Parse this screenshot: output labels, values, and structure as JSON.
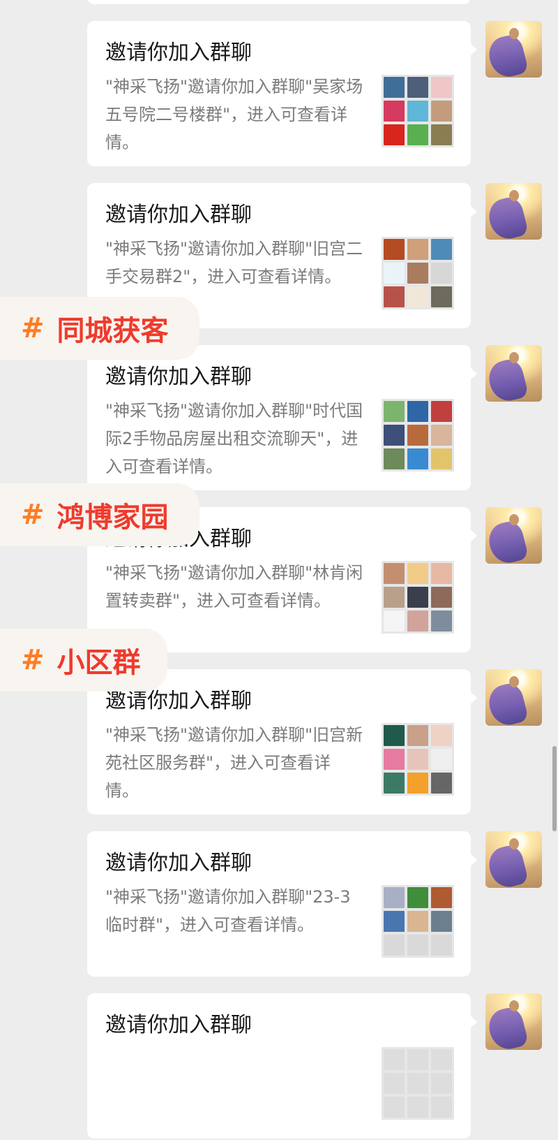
{
  "messages": [
    {
      "title": "邀请你加入群聊",
      "desc": "\"神采飞扬\"邀请你加入群聊\"吴家场五号院二号楼群\"，进入可查看详情。",
      "members": [
        "#3f6f98",
        "#4e5f79",
        "#f0c6c6",
        "#d53a5f",
        "#5fb7d8",
        "#c39c7d",
        "#d8261d",
        "#59b051",
        "#8a7d52"
      ]
    },
    {
      "title": "邀请你加入群聊",
      "desc": "\"神采飞扬\"邀请你加入群聊\"旧宫二手交易群2\"，进入可查看详情。",
      "members": [
        "#b54b22",
        "#cfa07a",
        "#4e8bb8",
        "#eaf3f8",
        "#a97b5f",
        "#d7d7d7",
        "#b7524a",
        "#f1e7d9",
        "#6d6b5b"
      ]
    },
    {
      "title": "邀请你加入群聊",
      "desc": "\"神采飞扬\"邀请你加入群聊\"时代国际2手物品房屋出租交流聊天\"，进入可查看详情。",
      "members": [
        "#7cb46e",
        "#2f66a7",
        "#c23f3f",
        "#3e4f7a",
        "#b96a3d",
        "#d8b59d",
        "#6d8a5b",
        "#3a8ad1",
        "#e2c46b"
      ]
    },
    {
      "title": "邀请你加入群聊",
      "desc": "\"神采飞扬\"邀请你加入群聊\"林肯闲置转卖群\"，进入可查看详情。",
      "members": [
        "#c38f70",
        "#f2cb89",
        "#e7b9a5",
        "#b8a08a",
        "#3b3f4d",
        "#8e6a5b",
        "#f5f5f5",
        "#d2a39b",
        "#7d8d9e"
      ]
    },
    {
      "title": "邀请你加入群聊",
      "desc": "\"神采飞扬\"邀请你加入群聊\"旧宫新苑社区服务群\"，进入可查看详情。",
      "members": [
        "#1f5a4b",
        "#c9a089",
        "#f0d1c5",
        "#e77aa0",
        "#e6c4b9",
        "#efefef",
        "#3d7a65",
        "#f4a12b",
        "#666666"
      ]
    },
    {
      "title": "邀请你加入群聊",
      "desc": "\"神采飞扬\"邀请你加入群聊\"23-3临时群\"，进入可查看详情。",
      "members": [
        "#a8b0c5",
        "#3f8e3a",
        "#b05a32",
        "#4a76b0",
        "#d9b592",
        "#6b7f8f",
        "#d9d9d9",
        "#d9d9d9",
        "#d9d9d9"
      ]
    },
    {
      "title": "邀请你加入群聊",
      "desc": "",
      "members": [
        "#dddddd",
        "#dddddd",
        "#dddddd",
        "#dddddd",
        "#dddddd",
        "#dddddd",
        "#dddddd",
        "#dddddd",
        "#dddddd"
      ]
    }
  ],
  "tags": [
    {
      "hash": "#",
      "text": "同城获客"
    },
    {
      "hash": "#",
      "text": "鸿博家园"
    },
    {
      "hash": "#",
      "text": "小区群"
    }
  ]
}
